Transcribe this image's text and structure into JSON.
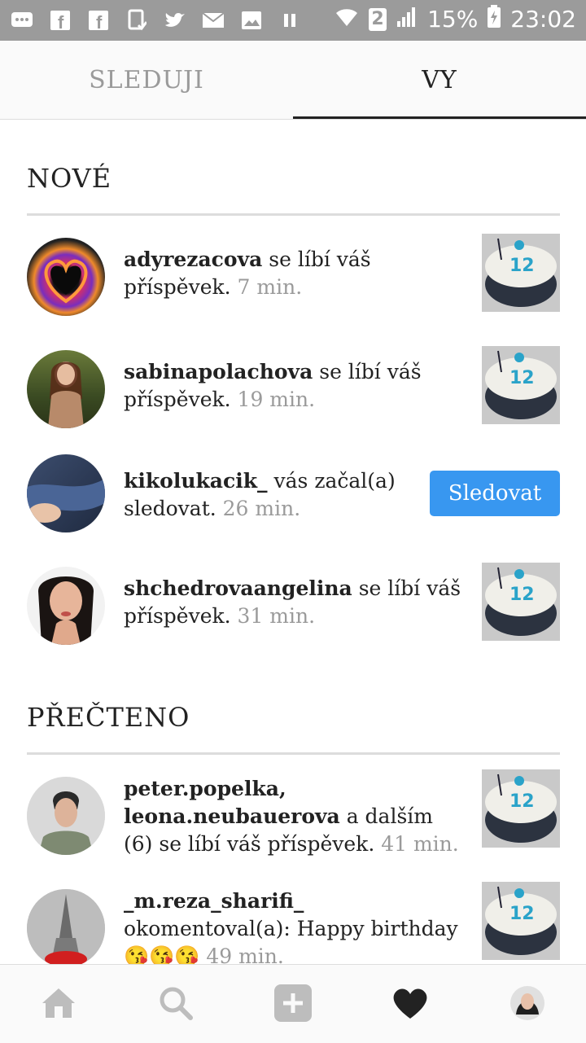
{
  "status_bar": {
    "left_icons": [
      "message-icon",
      "facebook-icon",
      "facebook-icon",
      "screen-icon",
      "twitter-icon",
      "mail-icon",
      "image-icon",
      "pause-icon"
    ],
    "sim_slot": "2",
    "battery": "15%",
    "time": "23:02"
  },
  "tabs": [
    {
      "label": "SLEDUJI",
      "active": false
    },
    {
      "label": "VY",
      "active": true
    }
  ],
  "sections": {
    "new_title": "NOVÉ",
    "read_title": "PŘEČTENO"
  },
  "notifications_new": [
    {
      "user": "adyrezacova",
      "action": "se líbí váš příspěvek.",
      "time": "7 min.",
      "trailing": "thumbnail"
    },
    {
      "user": "sabinapolachova",
      "action": "se líbí váš příspěvek.",
      "time": "19 min.",
      "trailing": "thumbnail"
    },
    {
      "user": "kikolukacik_",
      "action": "vás začal(a) sledovat.",
      "time": "26 min.",
      "trailing": "follow",
      "follow_label": "Sledovat"
    },
    {
      "user": "shchedrovaangelina",
      "action": "se líbí váš příspěvek.",
      "time": "31 min.",
      "trailing": "thumbnail"
    }
  ],
  "notifications_read": [
    {
      "user": "peter.popelka, leona.neubauerova",
      "action": "a dalším (6) se líbí váš příspěvek.",
      "time": "41 min.",
      "trailing": "thumbnail"
    },
    {
      "user": "_m.reza_sharifi_",
      "action": "okomentoval(a): Happy birthday😘😘😘",
      "time": "49 min.",
      "trailing": "thumbnail"
    }
  ],
  "bottom_nav": [
    "home-icon",
    "search-icon",
    "add-icon",
    "heart-icon",
    "profile-avatar"
  ],
  "colors": {
    "accent": "#3897f0",
    "muted": "#9a9a9a",
    "statusbar": "#9b9b9b"
  }
}
